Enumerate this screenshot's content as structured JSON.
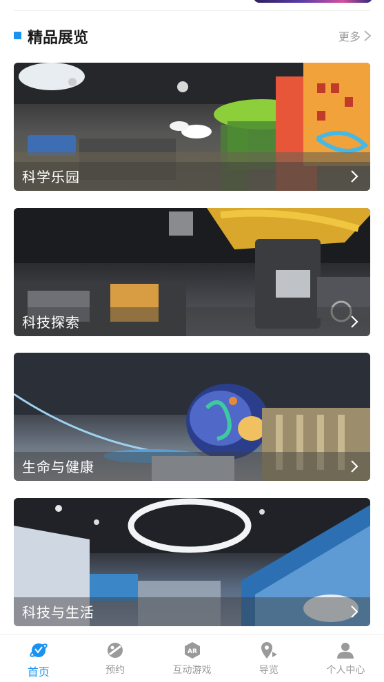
{
  "section": {
    "title": "精品展览",
    "more_label": "更多"
  },
  "exhibits": [
    {
      "label": "科学乐园"
    },
    {
      "label": "科技探索"
    },
    {
      "label": "生命与健康"
    },
    {
      "label": "科技与生活"
    }
  ],
  "tabbar": {
    "items": [
      {
        "label": "首页",
        "icon": "home-planet-icon",
        "active": true
      },
      {
        "label": "预约",
        "icon": "reserve-icon",
        "active": false
      },
      {
        "label": "互动游戏",
        "icon": "ar-game-icon",
        "active": false
      },
      {
        "label": "导览",
        "icon": "map-pin-icon",
        "active": false
      },
      {
        "label": "个人中心",
        "icon": "user-icon",
        "active": false
      }
    ],
    "active_color": "#1a93f0",
    "inactive_color": "#9a9a9a"
  },
  "colors": {
    "accent": "#1a93f0",
    "caption_text": "#ffffff"
  }
}
